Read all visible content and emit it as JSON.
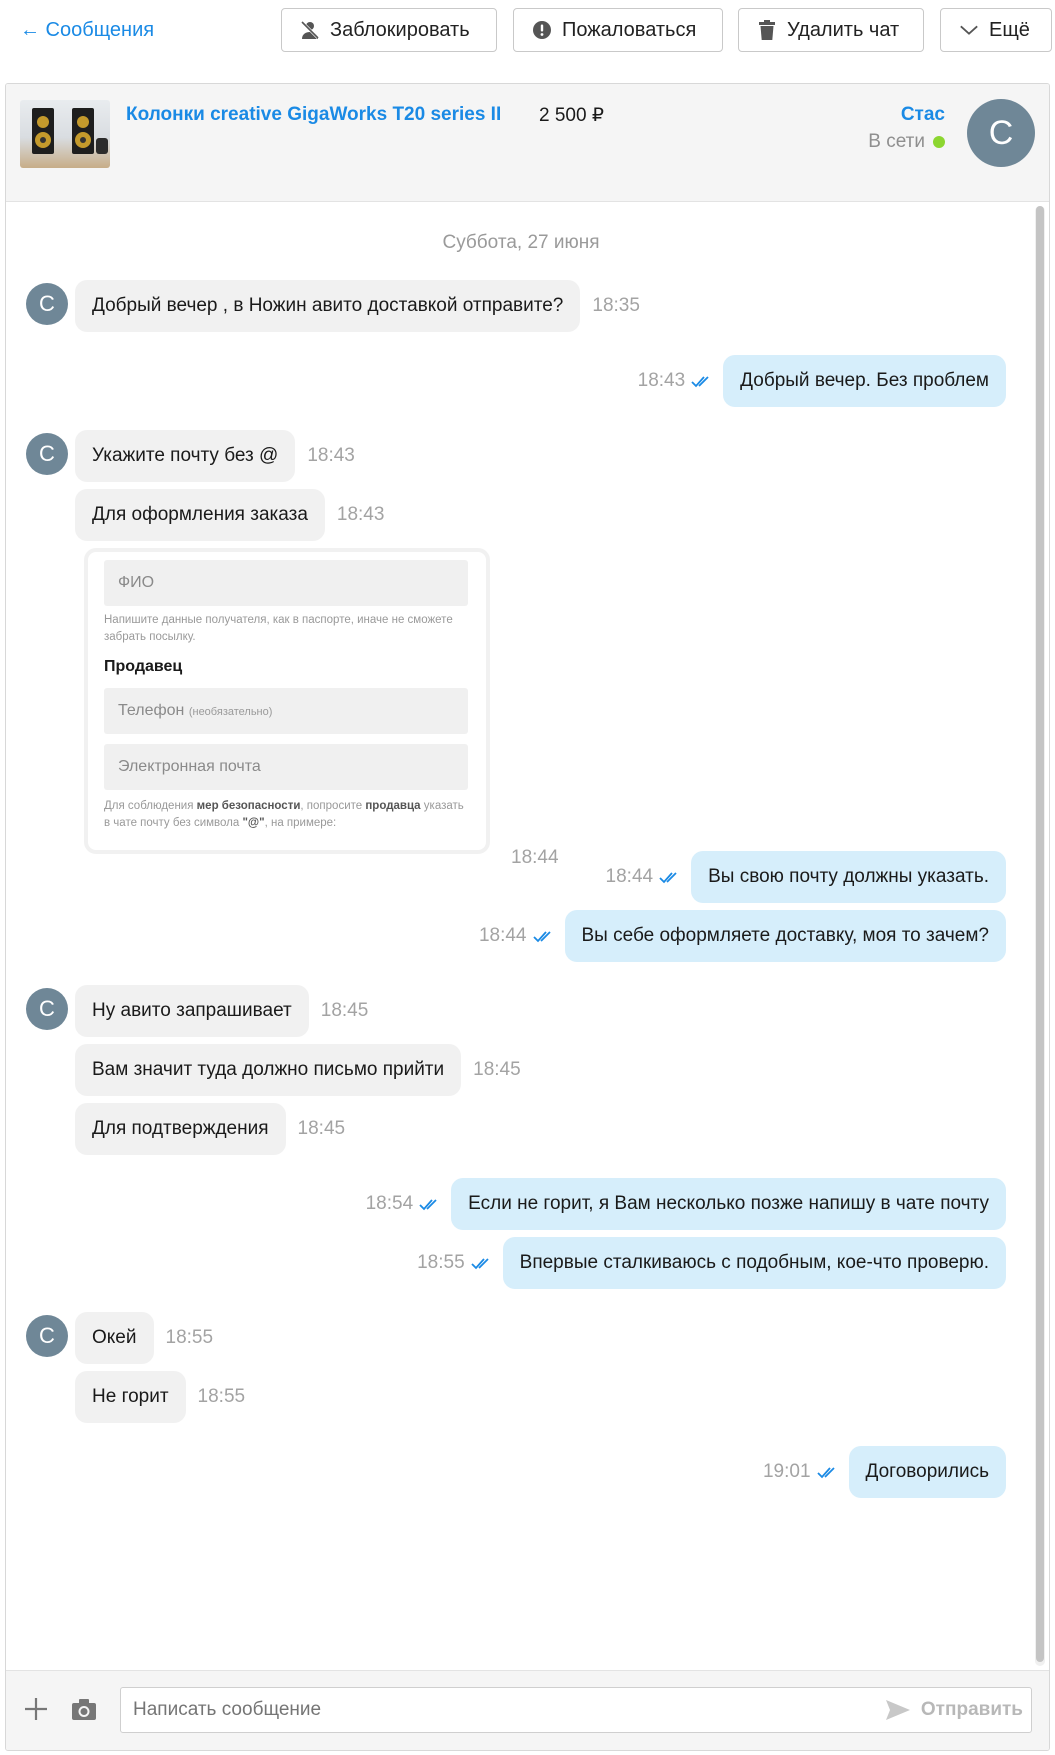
{
  "topbar": {
    "back_label": "← Сообщения",
    "block_label": "Заблокировать",
    "report_label": "Пожаловаться",
    "delete_label": "Удалить чат",
    "more_label": "Ещё"
  },
  "item": {
    "title": "Колонки creative GigaWorks T20 series II",
    "price": "2 500 ₽"
  },
  "seller": {
    "name": "Стас",
    "status": "В сети",
    "avatar_letter": "С"
  },
  "date_separator": "Суббота, 27 июня",
  "messages": [
    {
      "dir": "in",
      "text": "Добрый вечер , в Ножин авито доставкой отправите?",
      "time": "18:35"
    },
    {
      "dir": "out",
      "text": "Добрый вечер. Без проблем",
      "time": "18:43"
    },
    {
      "dir": "in",
      "text": "Укажите почту без @",
      "time": "18:43"
    },
    {
      "dir": "in",
      "text": "Для оформления заказа",
      "time": "18:43"
    },
    {
      "dir": "in",
      "type": "image",
      "time": "18:44"
    },
    {
      "dir": "out",
      "text": "Вы свою почту должны указать.",
      "time": "18:44"
    },
    {
      "dir": "out",
      "text": "Вы себе оформляете доставку, моя то зачем?",
      "time": "18:44"
    },
    {
      "dir": "in",
      "text": "Ну авито запрашивает",
      "time": "18:45"
    },
    {
      "dir": "in",
      "text": "Вам значит туда должно письмо прийти",
      "time": "18:45"
    },
    {
      "dir": "in",
      "text": "Для подтверждения",
      "time": "18:45"
    },
    {
      "dir": "out",
      "text": "Если не горит, я Вам несколько позже напишу в чате почту",
      "time": "18:54"
    },
    {
      "dir": "out",
      "text": "Впервые сталкиваюсь с подобным, кое-что проверю.",
      "time": "18:55"
    },
    {
      "dir": "in",
      "text": "Окей",
      "time": "18:55"
    },
    {
      "dir": "in",
      "text": "Не горит",
      "time": "18:55"
    },
    {
      "dir": "out",
      "text": "Договорились",
      "time": "19:01"
    }
  ],
  "attachment": {
    "field_name": "ФИО",
    "name_hint": "Напишите данные получателя, как в паспорте, иначе не сможете забрать посылку.",
    "section_title": "Продавец",
    "field_phone": "Телефон",
    "field_phone_note": "(необязательно)",
    "field_email": "Электронная почта",
    "note_prefix": "Для соблюдения",
    "note_bold1": "мер безопасности",
    "note_mid": ", попросите",
    "note_bold2": "продавца",
    "note_suffix": "указать в чате почту без символа",
    "note_bold3": "\"@\"",
    "note_end": ", на примере:"
  },
  "composer": {
    "placeholder": "Написать сообщение",
    "send_label": "Отправить"
  },
  "colors": {
    "link": "#1a8ae5",
    "incoming_bubble": "#f1f1f1",
    "outgoing_bubble": "#d6eefb",
    "online": "#8cd630",
    "avatar": "#6f8797"
  }
}
